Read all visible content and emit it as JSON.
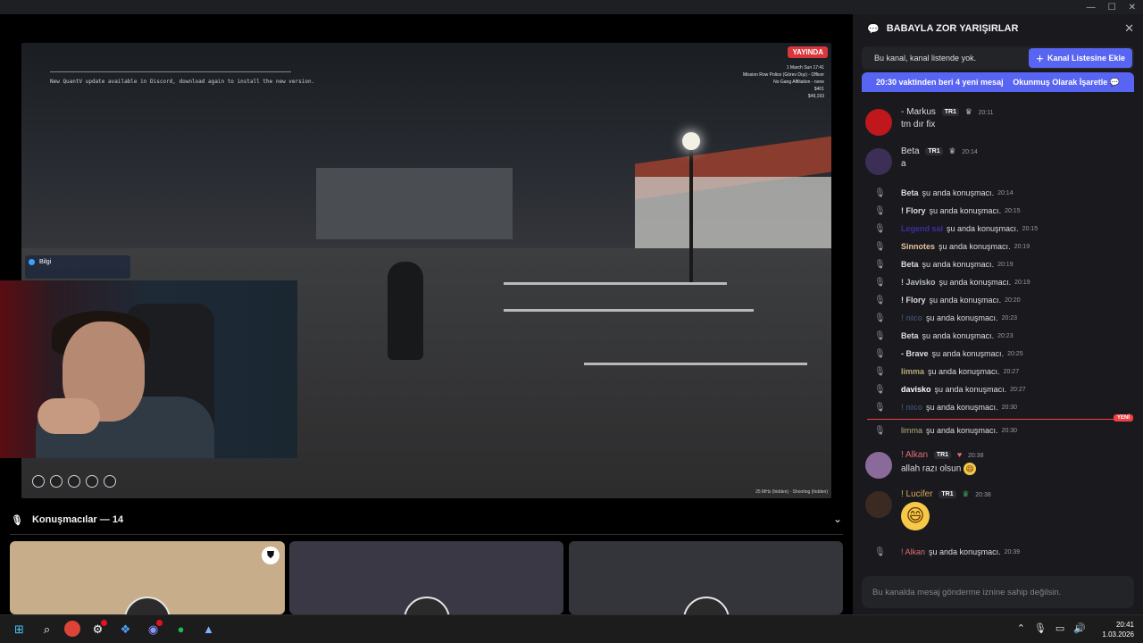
{
  "window": {
    "minimize": "—",
    "maximize": "☐",
    "close": "✕"
  },
  "stream": {
    "live_badge": "YAYINDA",
    "game_notice": "New QuantV update available in Discord, download again to install the new version.",
    "hud_lines": [
      "1 March Sun 17:41",
      "Mission Row Police (Görev Dışı) - Officer",
      "No Gang Affiliation - none",
      "$401",
      "$49,193"
    ],
    "bilgi_title": "Bilgi",
    "fps_text": "25 MHz (hidden) · Shooting (hidden)"
  },
  "speakers": {
    "label": "Konuşmacılar — 14"
  },
  "channel": {
    "name": "BABAYLA ZOR YARIŞIRLAR",
    "notice": "Bu kanal, kanal listende yok.",
    "add_button": "Kanal Listesine Ekle",
    "new_messages": "20:30 vaktinden beri 4 yeni mesaj",
    "mark_read": "Okunmuş Olarak İşaretle",
    "composer_placeholder": "Bu kanalda mesaj gönderme iznine sahip değilsin.",
    "new_label": "YENİ"
  },
  "messages": [
    {
      "user": "- Markus",
      "tag": "TR1",
      "time": "20:11",
      "text": "tm dır fix",
      "color": "#dbdee1",
      "avatar_color": "#c0171d"
    },
    {
      "user": "Beta",
      "tag": "TR1",
      "time": "20:14",
      "text": "a",
      "color": "#dbdee1",
      "avatar_color": "#3b2f55"
    }
  ],
  "system_messages": [
    {
      "user": "Beta",
      "action": "şu anda konuşmacı.",
      "time": "20:14",
      "color": "#dbdee1"
    },
    {
      "user": "! Flory",
      "action": "şu anda konuşmacı.",
      "time": "20:15",
      "color": "#dbdee1"
    },
    {
      "user": "Legend sal",
      "action": "şu anda konuşmacı.",
      "time": "20:15",
      "color": "#3b2fa0"
    },
    {
      "user": "Sinnotes",
      "action": "şu anda konuşmacı.",
      "time": "20:19",
      "color": "#e3c39d"
    },
    {
      "user": "Beta",
      "action": "şu anda konuşmacı.",
      "time": "20:19",
      "color": "#dbdee1"
    },
    {
      "user": "! Javisko",
      "action": "şu anda konuşmacı.",
      "time": "20:19",
      "color": "#b5bac1"
    },
    {
      "user": "! Flory",
      "action": "şu anda konuşmacı.",
      "time": "20:20",
      "color": "#dbdee1"
    },
    {
      "user": "! nico",
      "action": "şu anda konuşmacı.",
      "time": "20:23",
      "color": "#3a4a66"
    },
    {
      "user": "Beta",
      "action": "şu anda konuşmacı.",
      "time": "20:23",
      "color": "#dbdee1"
    },
    {
      "user": "- Brave",
      "action": "şu anda konuşmacı.",
      "time": "20:25",
      "color": "#dbdee1"
    },
    {
      "user": "limma",
      "action": "şu anda konuşmacı.",
      "time": "20:27",
      "color": "#b7a97a"
    },
    {
      "user": "davisko",
      "action": "şu anda konuşmacı.",
      "time": "20:27",
      "color": "#ffffff"
    },
    {
      "user": "! nico",
      "action": "şu anda konuşmacı.",
      "time": "20:30",
      "color": "#3a4a66"
    },
    {
      "user": "limma",
      "action": "şu anda konuşmacı.",
      "time": "20:30",
      "color": "#b7a97a"
    }
  ],
  "later_messages": [
    {
      "user": "! Alkan",
      "tag": "TR1",
      "time": "20:38",
      "text": "allah razı olsun",
      "emoji": "😄",
      "color": "#e06c75",
      "avatar_color": "#8a6a9a"
    },
    {
      "user": "! Lucifer",
      "tag": "TR1",
      "time": "20:38",
      "emoji_big": "😄",
      "color": "#d8a65a",
      "avatar_color": "#3a2a22"
    }
  ],
  "last_system": {
    "user": "! Alkan",
    "action": "şu anda konuşmacı.",
    "time": "20:39",
    "color": "#e06c75"
  },
  "taskbar": {
    "time": "20:41",
    "date": "1.03.2026"
  }
}
